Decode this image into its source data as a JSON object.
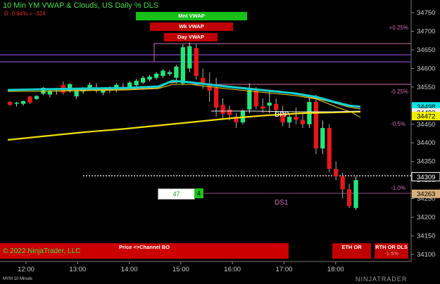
{
  "header": {
    "title": "10 Min YM VWAP & Clouds, US Daily % DLS",
    "change": "D -0.94% = -324"
  },
  "vwap_buttons": [
    {
      "label": "Mnt VWAP",
      "color": "#18c018"
    },
    {
      "label": "Wk VWAP",
      "color": "#c00000"
    },
    {
      "label": "Day VWAP",
      "color": "#c00000"
    }
  ],
  "price_axis": {
    "min": 34100,
    "max": 34750,
    "step": 50,
    "ticks": [
      "34750",
      "34700",
      "34650",
      "34600",
      "34550",
      "34500",
      "34450",
      "34400",
      "34350",
      "34300",
      "34250",
      "34200",
      "34150",
      "34100"
    ],
    "markers": [
      {
        "value": 34498,
        "label": "34498",
        "bg": "#00e6e6",
        "fg": "#000"
      },
      {
        "value": 34482,
        "label": "34482",
        "bg": "#e8e8e8",
        "fg": "#000"
      },
      {
        "value": 34472,
        "label": "34472",
        "bg": "#f0f000",
        "fg": "#000"
      },
      {
        "value": 34309,
        "label": "34309",
        "bg": "#000",
        "fg": "#fff",
        "border": "#fff"
      },
      {
        "value": 34263,
        "label": "34263",
        "bg": "#d8b07a",
        "fg": "#000"
      }
    ]
  },
  "time_axis": {
    "ticks": [
      "12:00",
      "13:00",
      "14:00",
      "15:00",
      "16:00",
      "17:00",
      "18:00"
    ]
  },
  "pct_levels": [
    "+0.25%",
    "-0.25%",
    "-0.5%",
    "-1.0%"
  ],
  "labels": {
    "dpp": "DPP",
    "ds1": "DS1"
  },
  "order_box": {
    "price": "47",
    "count": "4"
  },
  "footer": {
    "copyright": "© 2022 NinjaTrader, LLC",
    "center": "Price <>Channel BO",
    "eth": "ETH OR",
    "rth": "RTH OR DLS",
    "rth_pct": "-1.5%"
  },
  "instrument": "MYM 10 Minute",
  "watermark": "NINJATRADER",
  "candles": [
    [
      34510,
      34512,
      34500,
      34502
    ],
    [
      34506,
      34510,
      34498,
      34508
    ],
    [
      34505,
      34514,
      34500,
      34512
    ],
    [
      34525,
      34525,
      34505,
      34508
    ],
    [
      34518,
      34528,
      34516,
      34526
    ],
    [
      34532,
      34550,
      34528,
      34548
    ],
    [
      34530,
      34545,
      34522,
      34540
    ],
    [
      34542,
      34548,
      34530,
      34546
    ],
    [
      34556,
      34565,
      34530,
      34535
    ],
    [
      34540,
      34560,
      34535,
      34558
    ],
    [
      34525,
      34545,
      34518,
      34540
    ],
    [
      34538,
      34550,
      34532,
      34545
    ],
    [
      34544,
      34562,
      34540,
      34556
    ],
    [
      34540,
      34560,
      34535,
      34545
    ],
    [
      34535,
      34548,
      34528,
      34542
    ],
    [
      34545,
      34552,
      34535,
      34548
    ],
    [
      34542,
      34560,
      34536,
      34556
    ],
    [
      34546,
      34560,
      34542,
      34550
    ],
    [
      34550,
      34566,
      34545,
      34562
    ],
    [
      34555,
      34572,
      34550,
      34567
    ],
    [
      34562,
      34580,
      34558,
      34575
    ],
    [
      34570,
      34582,
      34565,
      34578
    ],
    [
      34575,
      34590,
      34570,
      34586
    ],
    [
      34580,
      34598,
      34575,
      34594
    ],
    [
      34585,
      34596,
      34580,
      34590
    ],
    [
      34575,
      34610,
      34560,
      34605
    ],
    [
      34560,
      34665,
      34555,
      34657
    ],
    [
      34600,
      34670,
      34590,
      34660
    ],
    [
      34655,
      34665,
      34570,
      34580
    ],
    [
      34575,
      34600,
      34545,
      34560
    ],
    [
      34560,
      34590,
      34510,
      34540
    ],
    [
      34548,
      34575,
      34470,
      34495
    ],
    [
      34502,
      34520,
      34462,
      34478
    ],
    [
      34490,
      34500,
      34460,
      34475
    ],
    [
      34470,
      34480,
      34440,
      34455
    ],
    [
      34455,
      34490,
      34450,
      34485
    ],
    [
      34490,
      34560,
      34480,
      34542
    ],
    [
      34540,
      34550,
      34490,
      34498
    ],
    [
      34498,
      34520,
      34480,
      34492
    ],
    [
      34500,
      34540,
      34480,
      34508
    ],
    [
      34505,
      34520,
      34470,
      34488
    ],
    [
      34480,
      34500,
      34445,
      34455
    ],
    [
      34455,
      34480,
      34440,
      34470
    ],
    [
      34470,
      34495,
      34450,
      34462
    ],
    [
      34462,
      34480,
      34440,
      34450
    ],
    [
      34450,
      34520,
      34440,
      34510
    ],
    [
      34510,
      34530,
      34370,
      34385
    ],
    [
      34385,
      34460,
      34370,
      34440
    ],
    [
      34440,
      34450,
      34320,
      34330
    ],
    [
      34330,
      34350,
      34300,
      34310
    ],
    [
      34310,
      34320,
      34250,
      34275
    ],
    [
      34275,
      34290,
      34225,
      34230
    ],
    [
      34225,
      34310,
      34220,
      34300
    ]
  ]
}
